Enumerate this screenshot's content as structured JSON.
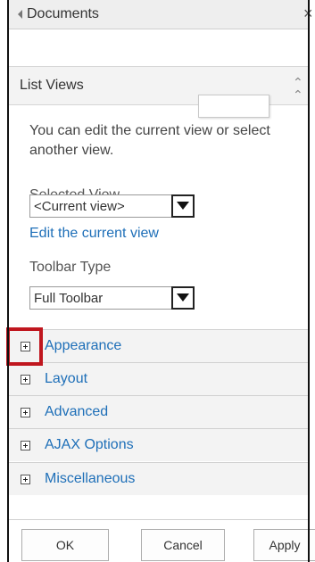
{
  "header": {
    "title": "Documents",
    "close_label": "×"
  },
  "section": {
    "title": "List Views"
  },
  "description": "You can edit the current view or select another view.",
  "selected_view": {
    "label": "Selected View",
    "value": "<Current view>"
  },
  "edit_link": "Edit the current view",
  "toolbar_type": {
    "label": "Toolbar Type",
    "value": "Full Toolbar"
  },
  "panels": [
    {
      "label": "Appearance"
    },
    {
      "label": "Layout"
    },
    {
      "label": "Advanced"
    },
    {
      "label": "AJAX Options"
    },
    {
      "label": "Miscellaneous"
    }
  ],
  "buttons": {
    "ok": "OK",
    "cancel": "Cancel",
    "apply": "Apply"
  },
  "colors": {
    "link": "#1e6fb8",
    "highlight": "#c0161e",
    "panel_bg": "#f3f3f3"
  }
}
